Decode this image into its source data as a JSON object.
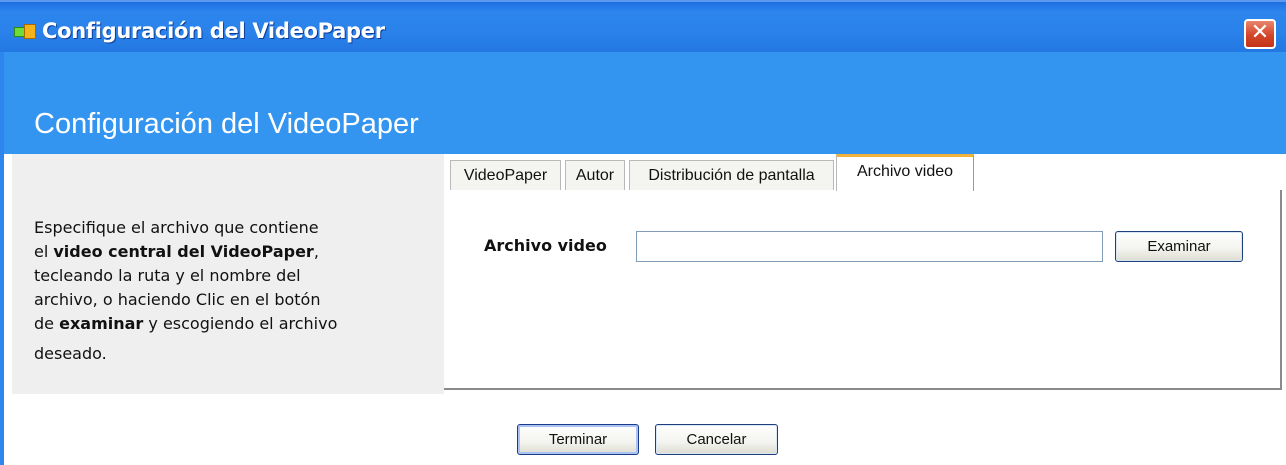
{
  "window": {
    "title": "Configuración del VideoPaper",
    "close_glyph": "✕",
    "icon": "videopaper-app-icon"
  },
  "header": {
    "title": "Configuración del VideoPaper"
  },
  "help": {
    "line1": "Especifique el archivo que contiene",
    "line2_prefix": "el ",
    "line2_bold": "video central del VideoPaper",
    "line2_suffix": ",",
    "line3": "tecleando la ruta y el nombre del",
    "line4": "archivo, o haciendo Clic en el botón",
    "line5_prefix": "de ",
    "line5_bold": "examinar",
    "line5_suffix": " y escogiendo el archivo",
    "line6": "deseado."
  },
  "tabs": [
    {
      "label": "VideoPaper",
      "active": false
    },
    {
      "label": "Autor",
      "active": false
    },
    {
      "label": "Distribución de pantalla",
      "active": false
    },
    {
      "label": "Archivo video",
      "active": true
    }
  ],
  "form": {
    "file_label": "Archivo video",
    "file_value": "",
    "browse_label": "Examinar"
  },
  "footer": {
    "finish_label": "Terminar",
    "cancel_label": "Cancelar"
  },
  "colors": {
    "titlebar": "#2c86ee",
    "header_band": "#3395f0",
    "active_tab_accent": "#f1b23c",
    "left_pane": "#efefef"
  }
}
